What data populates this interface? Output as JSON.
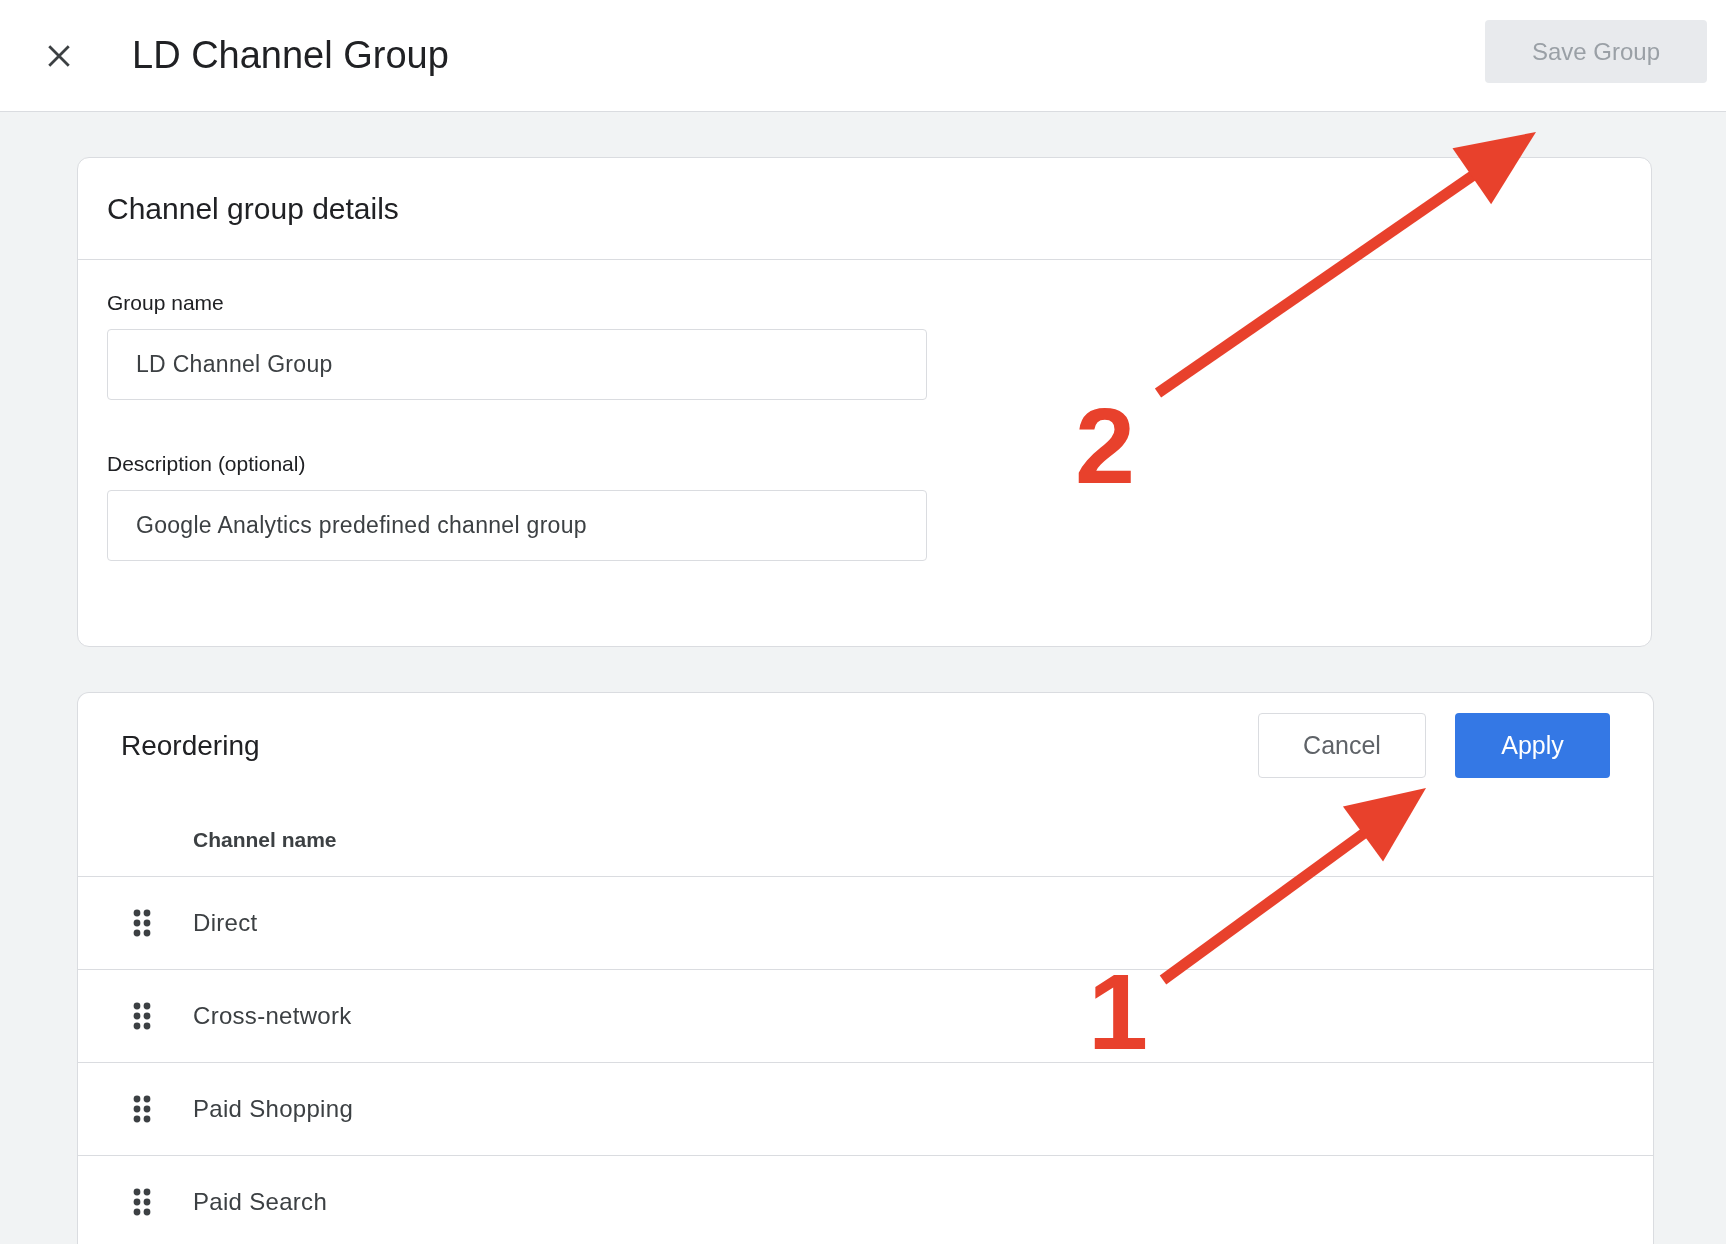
{
  "header": {
    "title": "LD Channel Group",
    "save_button": {
      "label": "Save Group",
      "disabled": true
    }
  },
  "details_card": {
    "title": "Channel group details",
    "fields": [
      {
        "label": "Group name",
        "value": "LD Channel Group"
      },
      {
        "label": "Description (optional)",
        "value": "Google Analytics predefined channel group"
      }
    ]
  },
  "reordering_card": {
    "title": "Reordering",
    "buttons": [
      {
        "label": "Cancel",
        "kind": "secondary"
      },
      {
        "label": "Apply",
        "kind": "primary"
      }
    ],
    "column": "Channel name",
    "rows": [
      "Direct",
      "Cross-network",
      "Paid Shopping",
      "Paid Search"
    ]
  },
  "annotations": [
    {
      "label": "2"
    },
    {
      "label": "1"
    }
  ]
}
